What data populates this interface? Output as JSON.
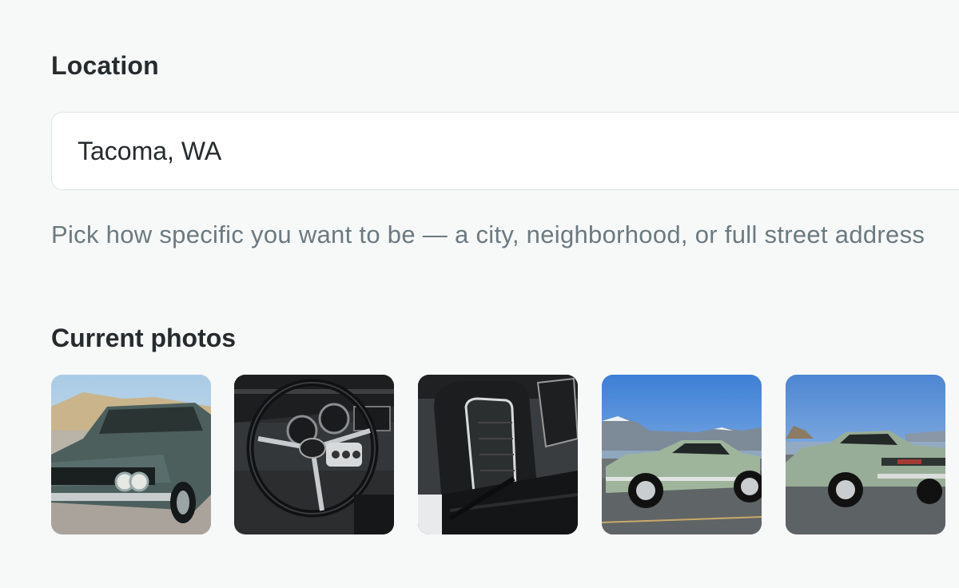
{
  "location": {
    "label": "Location",
    "value": "Tacoma, WA",
    "helper": "Pick how specific you want to be — a city, neighborhood, or full street address"
  },
  "photos": {
    "label": "Current photos",
    "items": [
      {
        "subject": "car-front-three-quarter"
      },
      {
        "subject": "steering-wheel-dashboard"
      },
      {
        "subject": "bucket-seats"
      },
      {
        "subject": "car-side-profile"
      },
      {
        "subject": "car-rear-three-quarter"
      }
    ]
  }
}
